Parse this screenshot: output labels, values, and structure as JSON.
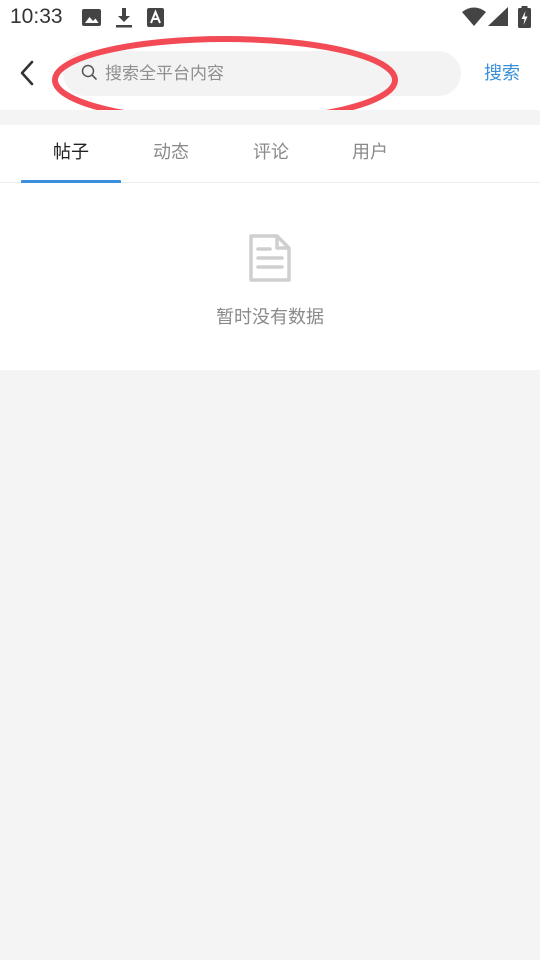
{
  "status_bar": {
    "time": "10:33",
    "left_icons": [
      "image-icon",
      "download-icon",
      "font-a-icon"
    ],
    "right_icons": [
      "wifi-icon",
      "cell-signal-icon",
      "battery-charging-icon"
    ]
  },
  "header": {
    "back_icon": "chevron-left-icon",
    "search_placeholder": "搜索全平台内容",
    "search_value": "",
    "search_button": "搜索"
  },
  "tabs": [
    {
      "label": "帖子",
      "active": true
    },
    {
      "label": "动态",
      "active": false
    },
    {
      "label": "评论",
      "active": false
    },
    {
      "label": "用户",
      "active": false
    }
  ],
  "empty_state": {
    "icon": "document-icon",
    "text": "暂时没有数据"
  },
  "colors": {
    "accent": "#3a8fdc",
    "annotation": "#f24b55",
    "background": "#f4f4f4"
  }
}
